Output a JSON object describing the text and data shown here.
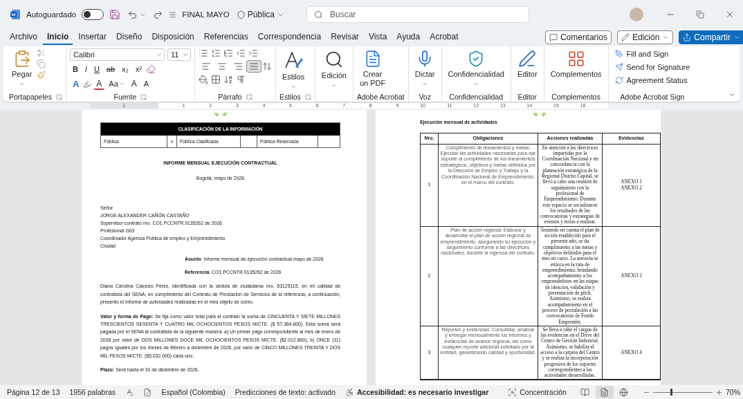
{
  "title_bar": {
    "autosave_label": "Autoguardado",
    "autosave_on": false,
    "document_name": "FINAL MAYO",
    "sensitivity": "Pública",
    "search_placeholder": "Buscar"
  },
  "menu_tabs": [
    {
      "label": "Archivo",
      "selected": false
    },
    {
      "label": "Inicio",
      "selected": true
    },
    {
      "label": "Insertar",
      "selected": false
    },
    {
      "label": "Diseño",
      "selected": false
    },
    {
      "label": "Disposición",
      "selected": false
    },
    {
      "label": "Referencias",
      "selected": false
    },
    {
      "label": "Correspondencia",
      "selected": false
    },
    {
      "label": "Revisar",
      "selected": false
    },
    {
      "label": "Vista",
      "selected": false
    },
    {
      "label": "Ayuda",
      "selected": false
    },
    {
      "label": "Acrobat",
      "selected": false
    }
  ],
  "header_buttons": {
    "comments": "Comentarios",
    "mode": "Edición",
    "share": "Compartir"
  },
  "ribbon": {
    "clipboard": {
      "paste": "Pegar",
      "label": "Portapapeles"
    },
    "font": {
      "label": "Fuente",
      "name": "Calibri",
      "size": "11",
      "style_buttons": [
        {
          "kind": "bold",
          "text": "B"
        },
        {
          "kind": "italic",
          "text": "I"
        },
        {
          "kind": "underline",
          "text": "U"
        },
        {
          "kind": "strike",
          "text": "ab"
        },
        {
          "kind": "sub",
          "text": "x₂"
        },
        {
          "kind": "super",
          "text": "x²"
        }
      ],
      "text_effects": "A",
      "font_color": "A",
      "case": "Aa",
      "grow": "A",
      "shrink": "A"
    },
    "paragraph": {
      "label": "Párrafo",
      "alignments": [
        {
          "kind": "left",
          "selected": false
        },
        {
          "kind": "center",
          "selected": false
        },
        {
          "kind": "right",
          "selected": false
        },
        {
          "kind": "justify",
          "selected": true
        }
      ]
    },
    "groups": [
      {
        "label": "Estilos",
        "launcher": true,
        "buttons": [
          {
            "kind": "styles",
            "label": "Estilos",
            "caret": true
          }
        ]
      },
      {
        "buttons": [
          {
            "kind": "find",
            "label": "Edición",
            "caret": true
          }
        ]
      },
      {
        "label": "Adobe Acrobat",
        "buttons": [
          {
            "kind": "pdf",
            "label": "Crear\nun PDF"
          }
        ]
      },
      {
        "label": "Voz",
        "buttons": [
          {
            "kind": "mic",
            "label": "Dictar",
            "caret": true
          }
        ]
      },
      {
        "label": "Confidencialidad",
        "buttons": [
          {
            "kind": "label",
            "label": "Confidencialidad",
            "caret": true
          }
        ]
      },
      {
        "label": "Editor",
        "buttons": [
          {
            "kind": "editor",
            "label": "Editor"
          }
        ]
      },
      {
        "label": "Complementos",
        "buttons": [
          {
            "kind": "addins",
            "label": "Complementos"
          }
        ]
      }
    ],
    "sign": {
      "label": "Adobe Acrobat Sign",
      "items": [
        {
          "kind": "fill",
          "label": "Fill and Sign"
        },
        {
          "kind": "send",
          "label": "Send for Signature"
        },
        {
          "kind": "status",
          "label": "Agreement Status"
        }
      ]
    }
  },
  "ruler": {
    "left_numbers": [
      "1"
    ],
    "numbers": [
      "1",
      "2",
      "3",
      "4",
      "5",
      "6",
      "7",
      "8",
      "9",
      "10",
      "11",
      "12",
      "13",
      "14",
      "15",
      "16"
    ]
  },
  "left_page": {
    "classification": {
      "title": "CLASIFICACIÓN DE LA INFORMACIÓN",
      "check_mark": "x",
      "options": [
        {
          "label": "Pública",
          "checked": true
        },
        {
          "label": "Pública Clasificada",
          "checked": false
        },
        {
          "label": "Pública Reservada",
          "checked": false
        }
      ]
    },
    "report_title": "INFORME MENSUAL EJECUCIÓN CONTRACTUAL",
    "place_date": "Bogotá, mayo de 2026",
    "recipient_lines": [
      "Señor",
      "JORGE ALEXANDER CAÑÓN CASTAÑO",
      "Supervisor contrato nro. CO1.PCCNTR.9135262 de 2026",
      "Profesional G03",
      "Coordinador Agencia Pública de empleo y Emprendimiento",
      "Ciudad"
    ],
    "subject": "**Asunto**: Informe mensual de ejecución contractual mayo de 2026",
    "reference": "**Referencia**: CO1.PCCNTR.9135262 de 2026",
    "paragraphs": [
      "Diana Carolina Caicedo Pérez, identificada con la cédula de ciudadanía nro. 53125115, en mi calidad de contratista del SENA, en cumplimiento del Contrato de Prestación de Servicios de la referencia, a continuación, presento el Informe de actividades realizadas en el mes objeto de cobro.",
      "**Valor y forma de Pago:** Se fija como valor total para el contrato la suma de CINCUENTA Y SIETE MILLONES TRESCIENTOS SESENTA Y CUATRO MIL OCHOCIENTOS PESOS M/CTE. ($ 57.364.800). Esta suma será pagada por el SENA al contratista de la siguiente manera: a) Un primer pago correspondiente al mes de enero de 2026 por valor de DOS MILLONES DOCE MIL OCHOCIENTOS PESOS M/CTE. ($2.012.800), b) ONCE (11) pagos iguales por los meses de febrero a diciembre de 2026, por valor de CINCO MILLONES TREINTA Y DOS MIL PESOS M/CTE. ($5.032.000) cada uno.",
      "**Plazo:** Será hasta el 31 de diciembre de 2026."
    ]
  },
  "right_page": {
    "heading": "Ejecución mensual de actividades",
    "columns": [
      "Nro.",
      "Obligaciones",
      "Acciones realizadas",
      "Evidencias"
    ],
    "rows": [
      {
        "number": "1",
        "obligation": "Cumplimiento de lineamientos y metas:\nEjecutar las actividades necesarias para dar soporte al cumplimiento de los lineamientos estratégicos, objetivos y metas definidos por la Dirección de Empleo y Trabajo y la Coordinación Nacional de Emprendimiento, en el marco del contrato.",
        "actions": "En atención a las directrices impartidas por la Coordinación Nacional y en concordancia con la planeación estratégica de la Regional Distrito Capital, se llevó a cabo una reunión de seguimiento con la profesional de Emprendimiento. Durante este espacio se socializaron los resultados de las convocatorias y estrategias de eventos y ferias a realizar.",
        "evidence": [
          "ANEXO 1",
          "ANEXO 2"
        ]
      },
      {
        "number": "2",
        "obligation": "Plan de acción regional: Elaborar y desarrollar el plan de acción regional de emprendimiento, asegurando su ejecución y seguimiento conforme a las directrices nacionales, durante la vigencia del contrato.",
        "actions": "Teniendo en cuenta el plan de acción establecido para el presente año, se da cumplimiento a las metas y objetivos definidos para el mes en curso. La asesoría se enfoca en la ruta de emprendimiento, brindando acompañamiento a los emprendedores en las etapas de ideación, validación y presentación de pitch. Asimismo, se realiza acompañamiento en el proceso de postulación a las convocatorias de Fondo Emprender.",
        "evidence": [
          "ANEXO 3"
        ]
      },
      {
        "number": "3",
        "obligation": "Reportes y evidencias: Consolidar, analizar y entregar mensualmente los informes y evidencias de avance regional, así como cualquier reporte adicional solicitado por la entidad, garantizando calidad y oportunidad.",
        "actions": "Se lleva a cabo el cargue de las evidencias en el Drive del Centro de Gestión Industrial. Asimismo, se habilita el acceso a la carpeta del Centro y se realiza la incorporación progresiva de los soportes correspondientes a las actividades desarrolladas.",
        "evidence": [
          "ANEXO 4"
        ]
      }
    ]
  },
  "status_bar": {
    "page": "Página 12 de 13",
    "words": "1956 palabras",
    "language": "Español (Colombia)",
    "predictions": "Predicciones de texto: activado",
    "accessibility": "Accesibilidad: es necesario investigar",
    "focus": "Concentración",
    "views": [
      {
        "kind": "read",
        "selected": false
      },
      {
        "kind": "print",
        "selected": true
      },
      {
        "kind": "web",
        "selected": false
      }
    ],
    "zoom": {
      "level": 0.3,
      "reading": "70%"
    }
  }
}
